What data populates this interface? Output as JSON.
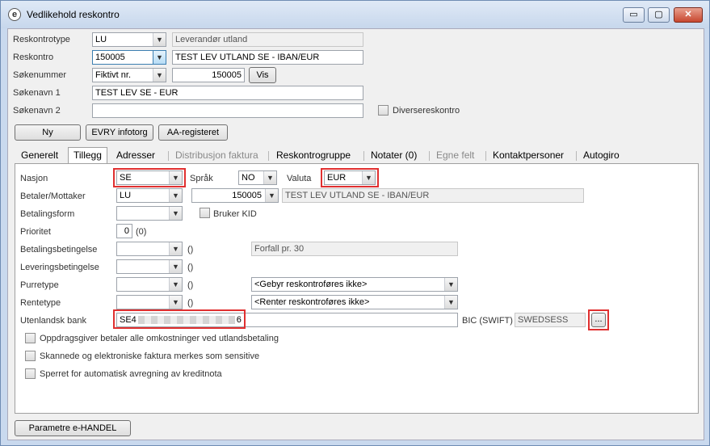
{
  "window": {
    "title": "Vedlikehold reskontro",
    "min": "▭",
    "max": "▢",
    "close": "✕"
  },
  "header": {
    "reskontrotype": {
      "label": "Reskontrotype",
      "value": "LU",
      "desc": "Leverandør utland"
    },
    "reskontro": {
      "label": "Reskontro",
      "value": "150005",
      "name": "TEST LEV UTLAND SE - IBAN/EUR"
    },
    "sokenummer": {
      "label": "Søkenummer",
      "type": "Fiktivt nr.",
      "value": "150005",
      "vis_label": "Vis"
    },
    "sokenavn1": {
      "label": "Søkenavn 1",
      "value": "TEST LEV SE - EUR"
    },
    "sokenavn2": {
      "label": "Søkenavn 2",
      "value": ""
    },
    "diverse_label": "Diversereskontro",
    "buttons": {
      "ny": "Ny",
      "evry": "EVRY infotorg",
      "aa": "AA-registeret"
    }
  },
  "tabs": [
    "Generelt",
    "Tillegg",
    "Adresser",
    "Distribusjon faktura",
    "Reskontrogruppe",
    "Notater (0)",
    "Egne felt",
    "Kontaktpersoner",
    "Autogiro"
  ],
  "tillegg": {
    "nasjon": {
      "label": "Nasjon",
      "value": "SE"
    },
    "sprak": {
      "label": "Språk",
      "value": "NO"
    },
    "valuta": {
      "label": "Valuta",
      "value": "EUR"
    },
    "betaler": {
      "label": "Betaler/Mottaker",
      "type": "LU",
      "number": "150005",
      "name": "TEST LEV UTLAND SE - IBAN/EUR"
    },
    "betalingsform": {
      "label": "Betalingsform",
      "value": "",
      "kid_label": "Bruker KID"
    },
    "prioritet": {
      "label": "Prioritet",
      "value": "0",
      "paren": "(0)"
    },
    "betalingsbetingelse": {
      "label": "Betalingsbetingelse",
      "value": "",
      "paren": "()",
      "desc": "Forfall pr. 30"
    },
    "leveringsbetingelse": {
      "label": "Leveringsbetingelse",
      "value": "",
      "paren": "()"
    },
    "purretype": {
      "label": "Purretype",
      "value": "",
      "paren": "()",
      "desc": "<Gebyr reskontroføres ikke>"
    },
    "rentetype": {
      "label": "Rentetype",
      "value": "",
      "paren": "()",
      "desc": "<Renter reskontroføres ikke>"
    },
    "bank": {
      "label": "Utenlandsk bank",
      "value_start": "SE4",
      "value_end": "6",
      "bic_label": "BIC (SWIFT)",
      "bic": "SWEDSESS",
      "browse": "..."
    },
    "checks": [
      "Oppdragsgiver betaler alle omkostninger ved utlandsbetaling",
      "Skannede og elektroniske faktura merkes som sensitive",
      "Sperret for automatisk avregning av kreditnota"
    ]
  },
  "footer": {
    "ehandel": "Parametre e-HANDEL"
  }
}
